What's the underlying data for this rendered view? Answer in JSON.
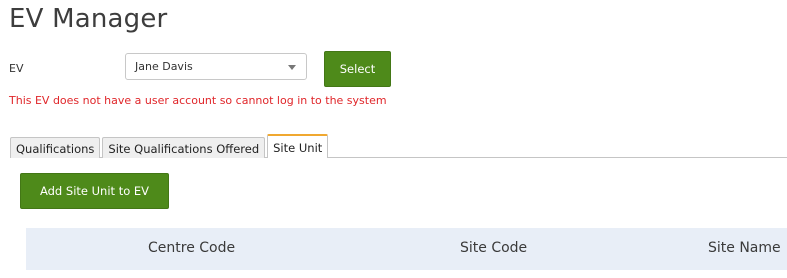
{
  "page": {
    "title": "EV Manager"
  },
  "ev_selector": {
    "label": "EV",
    "selected_value": "Jane Davis",
    "select_button_label": "Select",
    "warning": "This EV does not have a user account so cannot log in to the system"
  },
  "tabs": [
    {
      "label": "Qualifications",
      "active": false
    },
    {
      "label": "Site Qualifications Offered",
      "active": false
    },
    {
      "label": "Site Unit",
      "active": true
    }
  ],
  "site_unit": {
    "add_button_label": "Add Site Unit to EV",
    "table": {
      "columns": [
        "Centre Code",
        "Site Code",
        "Site Name"
      ]
    }
  },
  "colors": {
    "button_green": "#4e8a1a",
    "warning_red": "#e0262a",
    "active_tab_accent": "#f0a830",
    "table_header_bg": "#e8eef7"
  }
}
